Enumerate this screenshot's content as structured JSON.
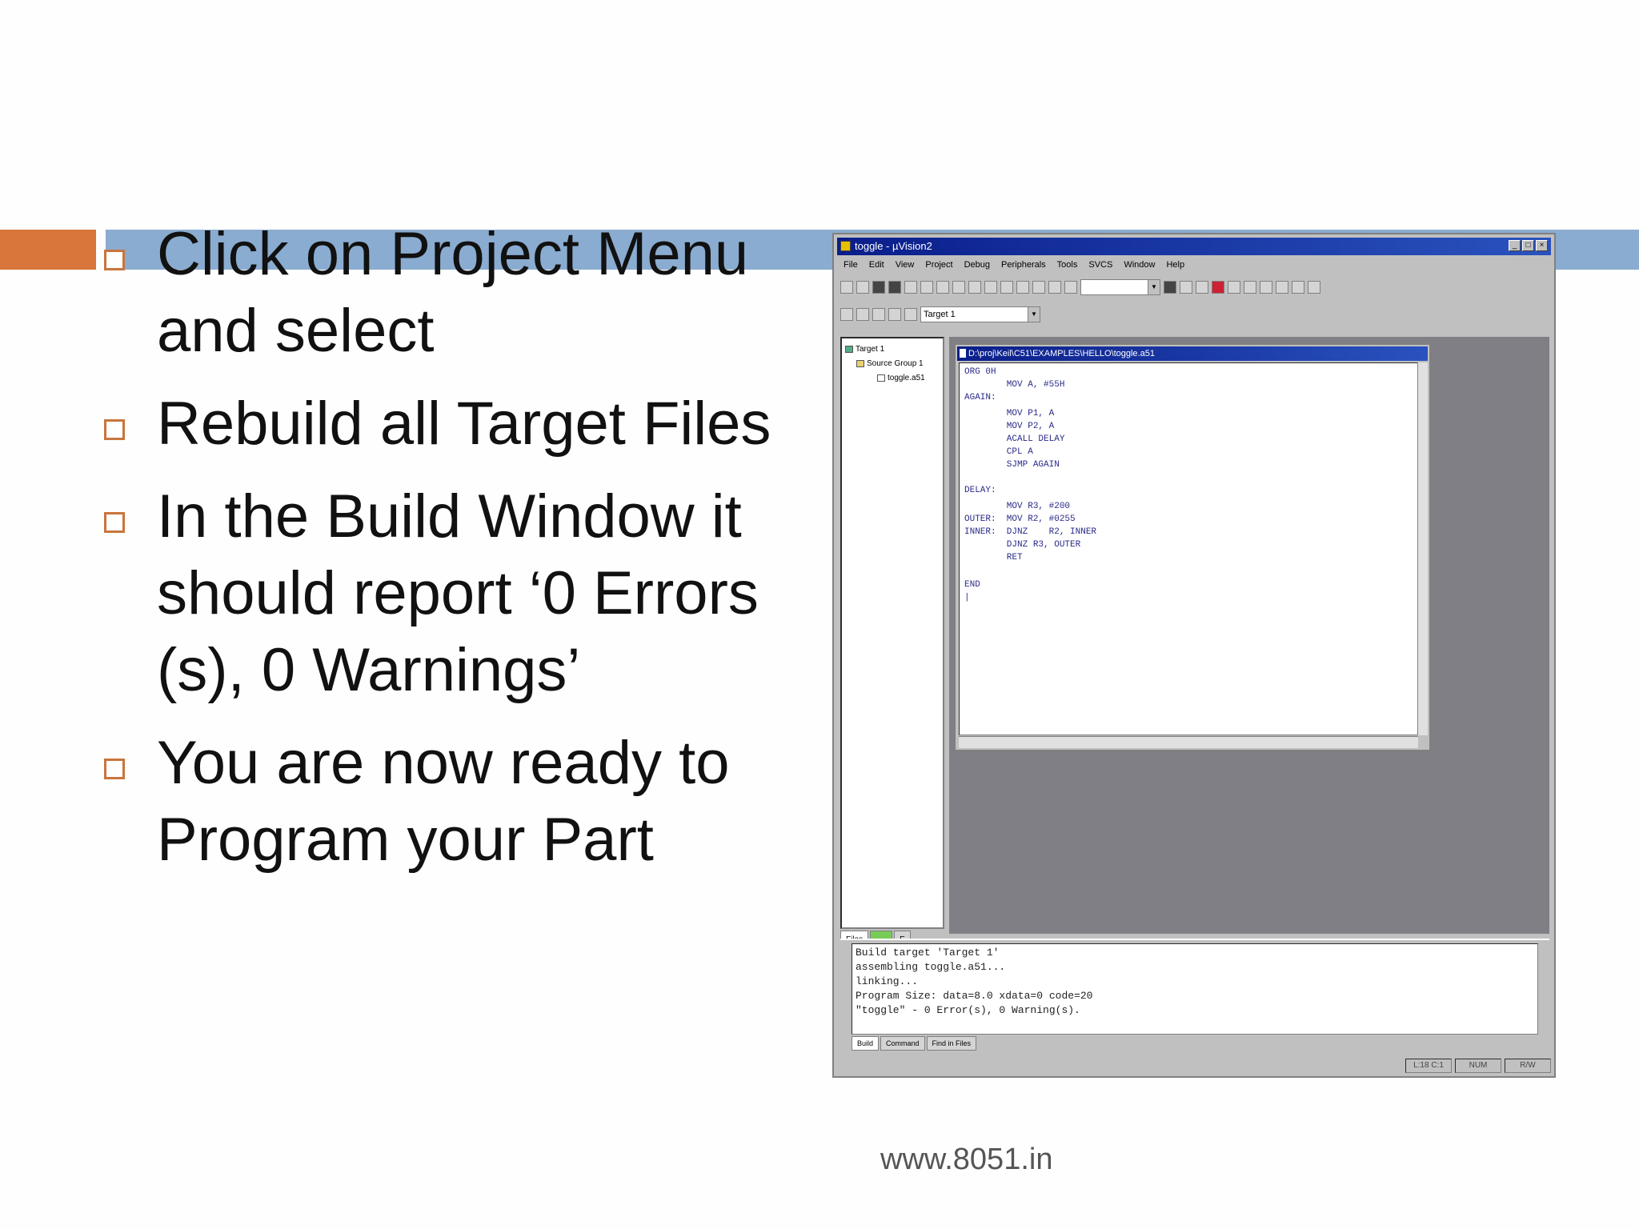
{
  "slide": {
    "bullets": [
      "Click on Project Menu and select",
      "Rebuild all Target Files",
      "In the Build Window it should report ‘0 Errors (s), 0 Warnings’",
      "You are now ready to Program your Part"
    ],
    "footer": "www.8051.in",
    "colors": {
      "accent_orange": "#d8763b",
      "accent_blue": "#8aacd0",
      "bullet_box": "#c8753c"
    }
  },
  "ide": {
    "title": "toggle - µVision2",
    "window_buttons": [
      "_",
      "□",
      "×"
    ],
    "menu": [
      "File",
      "Edit",
      "View",
      "Project",
      "Debug",
      "Peripherals",
      "Tools",
      "SVCS",
      "Window",
      "Help"
    ],
    "target_select": "Target 1",
    "project_tree": [
      "Target 1",
      "Source Group 1",
      "toggle.a51"
    ],
    "project_tabs": [
      "Files",
      "",
      "E"
    ],
    "editor": {
      "title": "D:\\proj\\Keil\\C51\\EXAMPLES\\HELLO\\toggle.a51",
      "code": [
        "ORG 0H",
        "        MOV A, #55H",
        "AGAIN:",
        "        MOV P1, A",
        "        MOV P2, A",
        "        ACALL DELAY",
        "        CPL A",
        "        SJMP AGAIN",
        "",
        "DELAY:",
        "        MOV R3, #200",
        "OUTER:  MOV R2, #0255",
        "INNER:  DJNZ    R2, INNER",
        "        DJNZ R3, OUTER",
        "        RET",
        "",
        "END",
        "|"
      ]
    },
    "build_output": [
      "Build target 'Target 1'",
      "assembling toggle.a51...",
      "linking...",
      "Program Size: data=8.0 xdata=0 code=20",
      "\"toggle\" - 0 Error(s), 0 Warning(s)."
    ],
    "output_tabs": [
      "Build",
      "Command",
      "Find in Files"
    ],
    "status": [
      "L:18 C:1",
      "NUM",
      "R/W"
    ]
  }
}
